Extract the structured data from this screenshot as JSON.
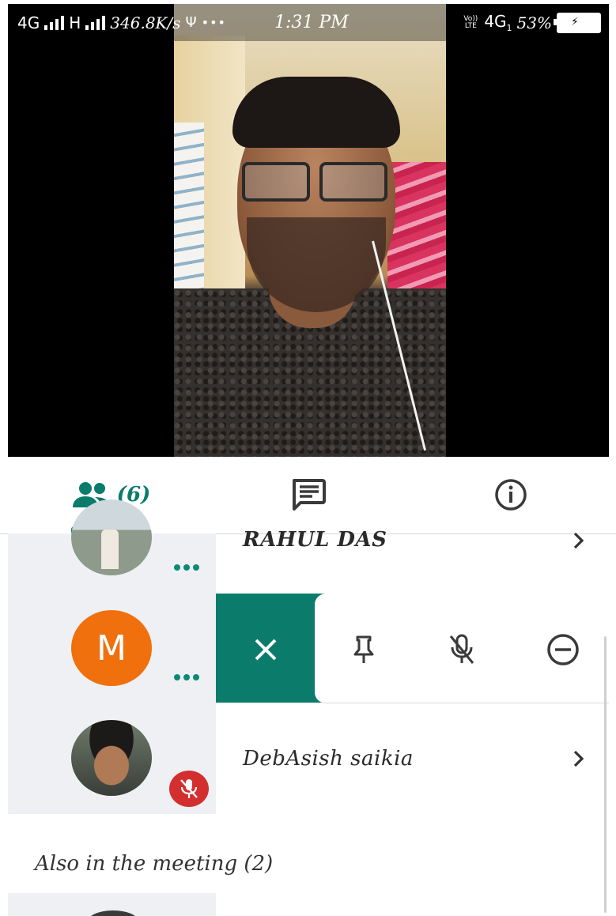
{
  "status_bar": {
    "network_left": "4G",
    "network_h": "H",
    "speed": "346.8K/s",
    "time": "1:31 PM",
    "volte": "Vo)) LTE",
    "network_right": "4G",
    "sim_index": "1",
    "battery_percent": "53%"
  },
  "tabs": {
    "people_count": "(6)",
    "active": "people"
  },
  "participants": [
    {
      "name": "RAHUL DAS"
    },
    {
      "avatar_letter": "M"
    },
    {
      "name": "DebAsish saikia",
      "muted": true
    }
  ],
  "actions": [
    "close",
    "pin",
    "mute",
    "remove"
  ],
  "also_in_meeting": "Also in the meeting (2)",
  "colors": {
    "accent": "#0b7b6b",
    "avatar_m": "#f0700e",
    "muted_badge": "#d32f2f"
  }
}
